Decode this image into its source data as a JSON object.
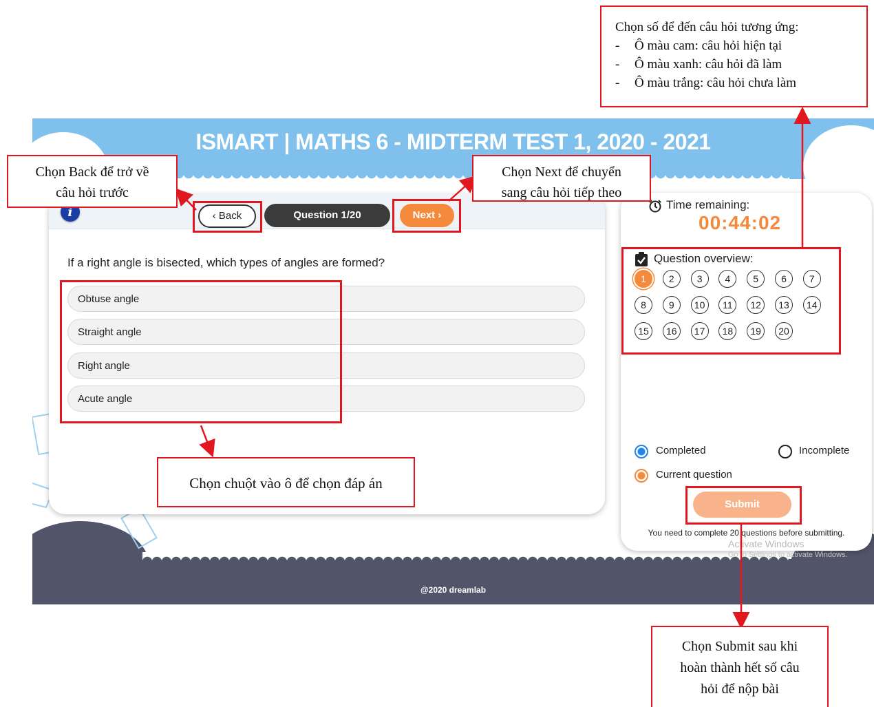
{
  "app": {
    "title": "ISMART | MATHS 6 - MIDTERM TEST 1, 2020 - 2021",
    "footer": "@2020 dreamlab"
  },
  "nav": {
    "back_label": "Back",
    "question_counter": "Question 1/20",
    "next_label": "Next"
  },
  "question": {
    "text": "If a right angle is bisected, which types of angles are formed?",
    "answers": [
      "Obtuse angle",
      "Straight angle",
      "Right angle",
      "Acute angle"
    ]
  },
  "sidebar": {
    "time_label": "Time remaining:",
    "time_value": "00:44:02",
    "overview_label": "Question overview:",
    "questions": [
      "1",
      "2",
      "3",
      "4",
      "5",
      "6",
      "7",
      "8",
      "9",
      "10",
      "11",
      "12",
      "13",
      "14",
      "15",
      "16",
      "17",
      "18",
      "19",
      "20"
    ],
    "current_question": "1",
    "legend": {
      "completed": "Completed",
      "incomplete": "Incomplete",
      "current": "Current question"
    },
    "submit_label": "Submit",
    "submit_note": "You need to complete 20 questions before submitting."
  },
  "os_watermark": {
    "title": "Activate Windows",
    "subtitle": "Go to Settings to activate Windows."
  },
  "annotations": {
    "back_note": [
      "Chọn Back để trở về",
      "câu hỏi trước"
    ],
    "next_note": [
      "Chọn Next để chuyển",
      "sang câu hỏi tiếp theo"
    ],
    "overview_note": {
      "heading": "Chọn số để đến câu hỏi tương ứng:",
      "items": [
        "Ô màu cam: câu hỏi hiện tại",
        "Ô màu xanh: câu hỏi đã làm",
        "Ô màu trắng: câu hỏi chưa làm"
      ]
    },
    "answer_note": "Chọn chuột vào ô để chọn đáp án",
    "submit_note": [
      "Chọn Submit sau khi",
      "hoàn thành hết số câu",
      "hỏi để nộp bài"
    ]
  },
  "colors": {
    "header": "#7fc1ec",
    "footer": "#525569",
    "accent": "#f58a3c",
    "annotation": "#e0171f",
    "completed": "#1e88e5"
  }
}
